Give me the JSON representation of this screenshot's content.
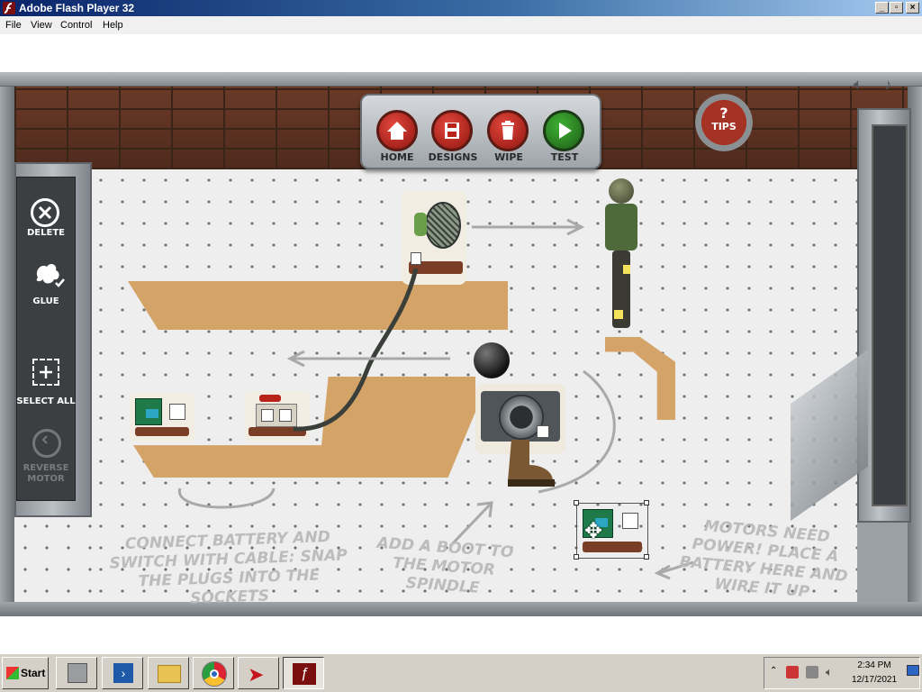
{
  "window": {
    "title": "Adobe Flash Player 32"
  },
  "menu": {
    "file": "File",
    "view": "View",
    "control": "Control",
    "help": "Help"
  },
  "nav": {
    "home": "HOME",
    "designs": "DESIGNS",
    "wipe": "WIPE",
    "test": "TEST",
    "tips": "TIPS"
  },
  "tools": {
    "delete": "DELETE",
    "glue": "GLUE",
    "select_all": "SELECT ALL",
    "reverse_motor": "REVERSE MOTOR"
  },
  "hints": {
    "battery": "CONNECT BATTERY AND SWITCH WITH CABLE: SNAP THE PLUGS INTO THE SOCKETS",
    "boot": "ADD A BOOT TO THE MOTOR SPINDLE",
    "power": "MOTORS NEED POWER! PLACE A BATTERY HERE AND WIRE IT UP"
  },
  "taskbar": {
    "start": "Start",
    "time": "2:34 PM",
    "date": "12/17/2021"
  },
  "colors": {
    "title_start": "#0a246a",
    "cork": "#d4a368",
    "button_red": "#b8231a",
    "button_green": "#2f7d25",
    "board": "#eeeeee"
  }
}
